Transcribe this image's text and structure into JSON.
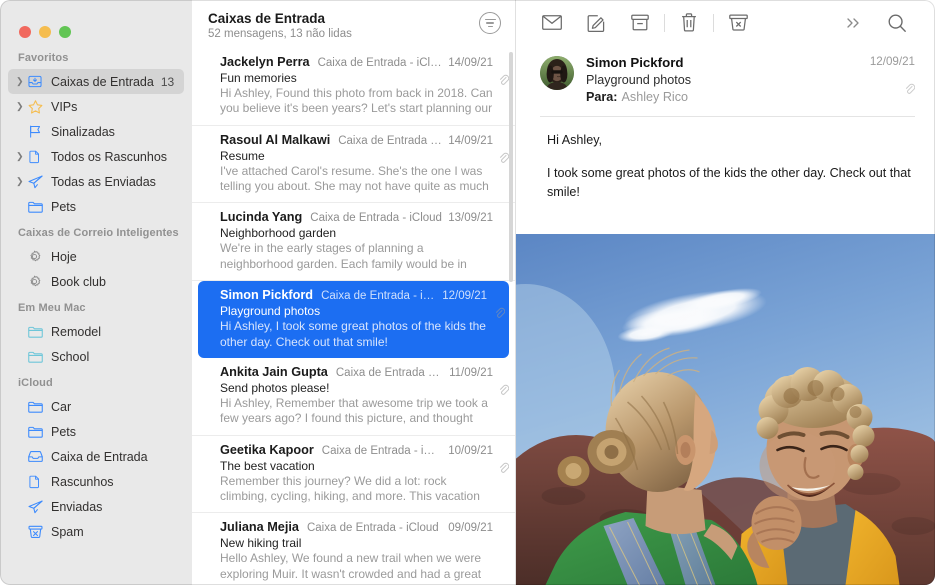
{
  "window": {
    "controls": [
      "close",
      "minimize",
      "zoom"
    ],
    "colors": {
      "accent_selected_row": "#1c6ef2",
      "sidebar_bg": "#e9e9e9",
      "sidebar_selected": "#d4d4d4",
      "icon_blue": "#3d8bfd",
      "icon_teal": "#6ec6d9",
      "icon_yellow": "#f5bd4f"
    }
  },
  "sidebar": {
    "sections": [
      {
        "title": "Favoritos",
        "items": [
          {
            "label": "Caixas de Entrada",
            "icon": "inbox-stack-icon",
            "disclosure": true,
            "count": "13",
            "selected": true,
            "tint": "blue"
          },
          {
            "label": "VIPs",
            "icon": "star-icon",
            "disclosure": true,
            "count": "",
            "selected": false,
            "tint": "yellow"
          },
          {
            "label": "Sinalizadas",
            "icon": "flag-icon",
            "disclosure": false,
            "count": "",
            "selected": false,
            "tint": "blue"
          },
          {
            "label": "Todos os Rascunhos",
            "icon": "document-icon",
            "disclosure": true,
            "count": "",
            "selected": false,
            "tint": "blue"
          },
          {
            "label": "Todas as Enviadas",
            "icon": "paper-plane-icon",
            "disclosure": true,
            "count": "",
            "selected": false,
            "tint": "blue"
          },
          {
            "label": "Pets",
            "icon": "folder-icon",
            "disclosure": false,
            "count": "",
            "selected": false,
            "tint": "blue"
          }
        ]
      },
      {
        "title": "Caixas de Correio Inteligentes",
        "items": [
          {
            "label": "Hoje",
            "icon": "gear-icon",
            "disclosure": false,
            "count": "",
            "selected": false,
            "tint": "gray"
          },
          {
            "label": "Book club",
            "icon": "gear-icon",
            "disclosure": false,
            "count": "",
            "selected": false,
            "tint": "gray"
          }
        ]
      },
      {
        "title": "Em Meu Mac",
        "items": [
          {
            "label": "Remodel",
            "icon": "folder-icon",
            "disclosure": false,
            "count": "",
            "selected": false,
            "tint": "teal"
          },
          {
            "label": "School",
            "icon": "folder-icon",
            "disclosure": false,
            "count": "",
            "selected": false,
            "tint": "teal"
          }
        ]
      },
      {
        "title": "iCloud",
        "items": [
          {
            "label": "Car",
            "icon": "folder-icon",
            "disclosure": false,
            "count": "",
            "selected": false,
            "tint": "blue"
          },
          {
            "label": "Pets",
            "icon": "folder-icon",
            "disclosure": false,
            "count": "",
            "selected": false,
            "tint": "blue"
          },
          {
            "label": "Caixa de Entrada",
            "icon": "inbox-icon",
            "disclosure": false,
            "count": "",
            "selected": false,
            "tint": "blue"
          },
          {
            "label": "Rascunhos",
            "icon": "document-icon",
            "disclosure": false,
            "count": "",
            "selected": false,
            "tint": "blue"
          },
          {
            "label": "Enviadas",
            "icon": "paper-plane-icon",
            "disclosure": false,
            "count": "",
            "selected": false,
            "tint": "blue"
          },
          {
            "label": "Spam",
            "icon": "junk-bin-icon",
            "disclosure": false,
            "count": "",
            "selected": false,
            "tint": "blue"
          }
        ]
      }
    ]
  },
  "message_list": {
    "title": "Caixas de Entrada",
    "subtitle": "52 mensagens, 13 não lidas",
    "filter_icon": "sort-filter-icon",
    "messages": [
      {
        "sender": "Jackelyn Perra",
        "mailbox": "Caixa de Entrada - iCloud",
        "date": "14/09/21",
        "subject": "Fun memories",
        "preview": "Hi Ashley, Found this photo from back in 2018. Can you believe it's been years? Let's start planning our next a…",
        "attachment": true,
        "selected": false
      },
      {
        "sender": "Rasoul Al Malkawi",
        "mailbox": "Caixa de Entrada - iC…",
        "date": "14/09/21",
        "subject": "Resume",
        "preview": "I've attached Carol's resume. She's the one I was telling you about. She may not have quite as much experienc…",
        "attachment": true,
        "selected": false
      },
      {
        "sender": "Lucinda Yang",
        "mailbox": "Caixa de Entrada - iCloud",
        "date": "13/09/21",
        "subject": "Neighborhood garden",
        "preview": "We're in the early stages of planning a neighborhood garden. Each family would be in charge of a plot. Bring…",
        "attachment": false,
        "selected": false
      },
      {
        "sender": "Simon Pickford",
        "mailbox": "Caixa de Entrada - iCloud",
        "date": "12/09/21",
        "subject": "Playground photos",
        "preview": "Hi Ashley, I took some great photos of the kids the other day. Check out that smile!",
        "attachment": true,
        "selected": true
      },
      {
        "sender": "Ankita Jain Gupta",
        "mailbox": "Caixa de Entrada - iC…",
        "date": "11/09/21",
        "subject": "Send photos please!",
        "preview": "Hi Ashley, Remember that awesome trip we took a few years ago? I found this picture, and thought about all y…",
        "attachment": true,
        "selected": false
      },
      {
        "sender": "Geetika Kapoor",
        "mailbox": "Caixa de Entrada - iCloud",
        "date": "10/09/21",
        "subject": "The best vacation",
        "preview": "Remember this journey? We did a lot: rock climbing, cycling, hiking, and more. This vacation was amazing.…",
        "attachment": true,
        "selected": false
      },
      {
        "sender": "Juliana Mejia",
        "mailbox": "Caixa de Entrada - iCloud",
        "date": "09/09/21",
        "subject": "New hiking trail",
        "preview": "Hello Ashley, We found a new trail when we were exploring Muir. It wasn't crowded and had a great view.…",
        "attachment": false,
        "selected": false
      }
    ]
  },
  "reader": {
    "toolbar": [
      {
        "name": "mark-unread-button",
        "icon": "envelope-icon"
      },
      {
        "name": "compose-button",
        "icon": "compose-pencil-icon"
      },
      {
        "name": "archive-button",
        "icon": "archive-box-icon"
      },
      {
        "name": "delete-button",
        "icon": "trash-icon"
      },
      {
        "name": "junk-button",
        "icon": "junk-bin-icon"
      },
      {
        "name": "more-button",
        "icon": "chevrons-right-icon"
      },
      {
        "name": "search-button",
        "icon": "search-icon"
      }
    ],
    "message": {
      "from": "Simon Pickford",
      "subject": "Playground photos",
      "to_label": "Para:",
      "to_value": "Ashley Rico",
      "date": "12/09/21",
      "attachment": true,
      "avatar": "contact-avatar",
      "body_paragraphs": [
        "Hi Ashley,",
        "I took some great photos of the kids the other day. Check out that smile!"
      ],
      "photo_attachment": "kids-outdoor-photo"
    }
  }
}
